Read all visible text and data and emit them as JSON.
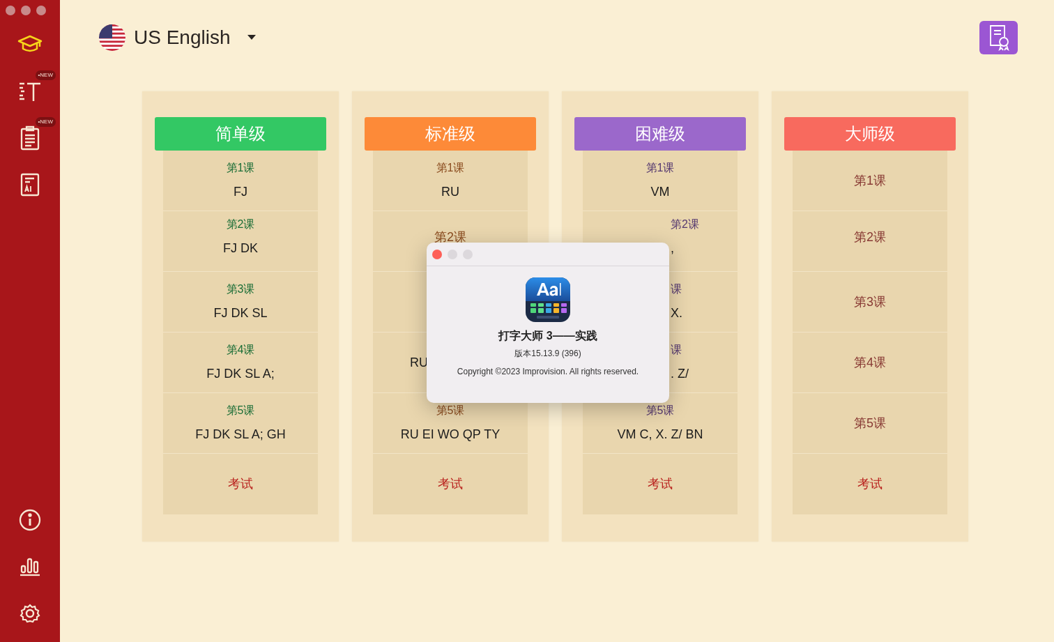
{
  "window": {
    "active": false
  },
  "sidebar": {
    "top_items": [
      {
        "kind": "course",
        "selected": true
      },
      {
        "kind": "text",
        "selected": false,
        "badge": "•NEW"
      },
      {
        "kind": "clipboard",
        "selected": false,
        "badge": "•NEW"
      },
      {
        "kind": "ai",
        "selected": false
      }
    ],
    "bottom_items": [
      {
        "kind": "info"
      },
      {
        "kind": "stats"
      },
      {
        "kind": "settings"
      }
    ]
  },
  "language": {
    "label": "US English"
  },
  "levels": [
    {
      "title": "简单级",
      "color": "#33c864",
      "lessons": [
        {
          "title": "第1课",
          "keys": "FJ"
        },
        {
          "title": "第2课",
          "keys": "FJ DK"
        },
        {
          "title": "第3课",
          "keys": "FJ DK SL"
        },
        {
          "title": "第4课",
          "keys": "FJ DK SL A;"
        },
        {
          "title": "第5课",
          "keys": "FJ DK SL A; GH"
        }
      ],
      "exam": "考试"
    },
    {
      "title": "标准级",
      "color": "#fd8a38",
      "lessons": [
        {
          "title": "第1课",
          "keys": "RU"
        },
        {
          "title": "第2课"
        },
        {
          "kind": "covered"
        },
        {
          "keys": "RU",
          "kind": "covered_right"
        },
        {
          "title": "第5课",
          "keys": "RU EI WO QP TY"
        }
      ],
      "exam": "考试"
    },
    {
      "title": "困难级",
      "color": "#9b68cb",
      "lessons": [
        {
          "title": "第1课",
          "keys": "VM"
        },
        {
          "title": "第2课",
          "keys": ",",
          "kind": "covered_left"
        },
        {
          "title": "课",
          "keys": "X.",
          "kind": "covered_left"
        },
        {
          "title": "课",
          "keys": ". Z/",
          "kind": "covered_left"
        },
        {
          "title": "第5课",
          "keys": "VM C, X. Z/ BN"
        }
      ],
      "exam": "考试"
    },
    {
      "title": "大师级",
      "color": "#f86a5e",
      "lessons": [
        {
          "title": "第1课"
        },
        {
          "title": "第2课"
        },
        {
          "title": "第3课"
        },
        {
          "title": "第4课"
        },
        {
          "title": "第5课"
        }
      ],
      "exam": "考试"
    }
  ],
  "about_dialog": {
    "app_name": "打字大师 3——实践",
    "version": "版本15.13.9 (396)",
    "copyright": "Copyright ©2023 Improvision. All rights reserved."
  }
}
